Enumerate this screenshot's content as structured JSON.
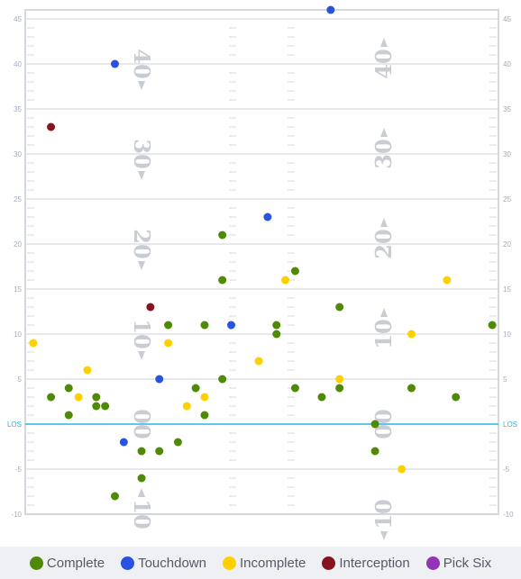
{
  "chart_data": {
    "type": "scatter",
    "xlim": [
      0,
      53.3
    ],
    "ylim": [
      -10,
      46
    ],
    "y_ticks": [
      45,
      40,
      35,
      30,
      25,
      20,
      15,
      10,
      5,
      0,
      -5,
      -10
    ],
    "y_tick_labels": [
      "45",
      "40",
      "35",
      "30",
      "25",
      "20",
      "15",
      "10",
      "5",
      "LOS",
      "-5",
      "-10"
    ],
    "grid": true,
    "line_of_scrimmage": 0,
    "legend_position": "bottom",
    "field_numbers_left": [
      {
        "yard": 40,
        "text": "40",
        "arrow": "down"
      },
      {
        "yard": 30,
        "text": "30",
        "arrow": "down"
      },
      {
        "yard": 20,
        "text": "20",
        "arrow": "down"
      },
      {
        "yard": 10,
        "text": "10",
        "arrow": "down"
      },
      {
        "yard": 0,
        "text": "00",
        "arrow": "none"
      },
      {
        "yard": -10,
        "text": "10",
        "arrow": "up"
      }
    ],
    "field_numbers_right": [
      {
        "yard": 40,
        "text": "40",
        "arrow": "up"
      },
      {
        "yard": 30,
        "text": "30",
        "arrow": "up"
      },
      {
        "yard": 20,
        "text": "20",
        "arrow": "up"
      },
      {
        "yard": 10,
        "text": "10",
        "arrow": "up"
      },
      {
        "yard": 0,
        "text": "00",
        "arrow": "none"
      },
      {
        "yard": -10,
        "text": "10",
        "arrow": "down"
      }
    ],
    "series": [
      {
        "name": "Complete",
        "color": "#4e8a06",
        "points": [
          [
            22.2,
            21
          ],
          [
            22.2,
            16
          ],
          [
            30.4,
            17
          ],
          [
            35.4,
            13
          ],
          [
            16.1,
            11
          ],
          [
            20.2,
            11
          ],
          [
            28.3,
            11
          ],
          [
            28.3,
            10
          ],
          [
            52.6,
            11
          ],
          [
            22.2,
            5
          ],
          [
            19.2,
            4
          ],
          [
            2.9,
            3
          ],
          [
            4.9,
            4
          ],
          [
            8.0,
            3
          ],
          [
            4.9,
            1
          ],
          [
            8.0,
            2
          ],
          [
            9.0,
            2
          ],
          [
            20.2,
            1
          ],
          [
            30.4,
            4
          ],
          [
            33.4,
            3
          ],
          [
            35.4,
            4
          ],
          [
            43.5,
            4
          ],
          [
            48.5,
            3
          ],
          [
            39.4,
            0
          ],
          [
            39.4,
            -3
          ],
          [
            17.2,
            -2
          ],
          [
            13.1,
            -3
          ],
          [
            15.1,
            -3
          ],
          [
            13.1,
            -6
          ],
          [
            10.1,
            -8
          ]
        ]
      },
      {
        "name": "Touchdown",
        "color": "#2a52e0",
        "points": [
          [
            34.4,
            46
          ],
          [
            10.1,
            40
          ],
          [
            27.3,
            23
          ],
          [
            23.2,
            11
          ],
          [
            15.1,
            5
          ],
          [
            11.1,
            -2
          ]
        ]
      },
      {
        "name": "Incomplete",
        "color": "#ffd000",
        "points": [
          [
            0.9,
            9
          ],
          [
            16.1,
            9
          ],
          [
            7.0,
            6
          ],
          [
            6.0,
            3
          ],
          [
            20.2,
            3
          ],
          [
            18.2,
            2
          ],
          [
            26.3,
            7
          ],
          [
            29.3,
            16
          ],
          [
            47.5,
            16
          ],
          [
            43.5,
            10
          ],
          [
            35.4,
            5
          ],
          [
            42.4,
            -5
          ]
        ]
      },
      {
        "name": "Interception",
        "color": "#85141e",
        "points": [
          [
            2.9,
            33
          ],
          [
            14.1,
            13
          ]
        ]
      },
      {
        "name": "Pick Six",
        "color": "#9333b5",
        "points": []
      }
    ]
  }
}
